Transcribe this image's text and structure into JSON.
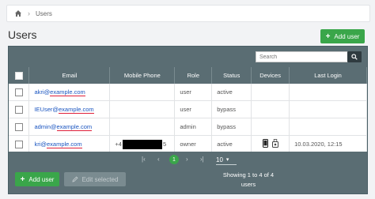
{
  "breadcrumb": {
    "current": "Users"
  },
  "page": {
    "title": "Users",
    "add_user_label": "Add user"
  },
  "search": {
    "placeholder": "Search"
  },
  "table": {
    "columns": [
      "Email",
      "Mobile Phone",
      "Role",
      "Status",
      "Devices",
      "Last Login"
    ],
    "rows": [
      {
        "email_user": "akri@",
        "email_domain": "example.com",
        "phone_prefix": "",
        "phone_suffix": "",
        "role": "user",
        "status": "active",
        "devices": false,
        "last_login": ""
      },
      {
        "email_user": "IEUser@",
        "email_domain": "example.com",
        "phone_prefix": "",
        "phone_suffix": "",
        "role": "user",
        "status": "bypass",
        "devices": false,
        "last_login": ""
      },
      {
        "email_user": "admin@",
        "email_domain": "example.com",
        "phone_prefix": "",
        "phone_suffix": "",
        "role": "admin",
        "status": "bypass",
        "devices": false,
        "last_login": ""
      },
      {
        "email_user": "kri@",
        "email_domain": "example.com",
        "phone_prefix": "+4",
        "phone_suffix": "5",
        "role": "owner",
        "status": "active",
        "devices": true,
        "last_login": "10.03.2020, 12:15"
      }
    ]
  },
  "pagination": {
    "current_page": "1",
    "page_size": "10"
  },
  "footer": {
    "add_user_label": "Add user",
    "edit_selected_label": "Edit selected",
    "showing_line1": "Showing 1 to 4 of 4",
    "showing_line2": "users"
  },
  "colors": {
    "accent_green": "#3aa64a",
    "header_slate": "#5a6d73",
    "email_underline": "#e0203a"
  }
}
